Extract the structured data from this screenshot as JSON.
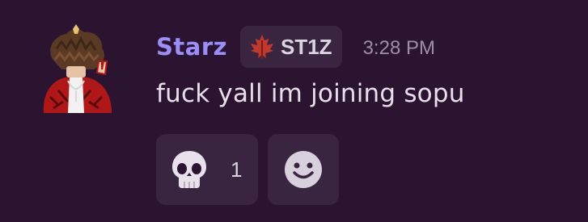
{
  "message": {
    "author": {
      "username": "Starz",
      "username_color": "#9b8ef7",
      "avatar_icon": "avatar-icon"
    },
    "tag": {
      "icon": "maple-leaf-icon",
      "text": "ST1Z"
    },
    "timestamp": "3:28 PM",
    "content": "fuck yall im joining sopu",
    "reactions": [
      {
        "emoji": "skull-icon",
        "count": "1"
      }
    ],
    "add_reaction_icon": "smiley-icon"
  }
}
